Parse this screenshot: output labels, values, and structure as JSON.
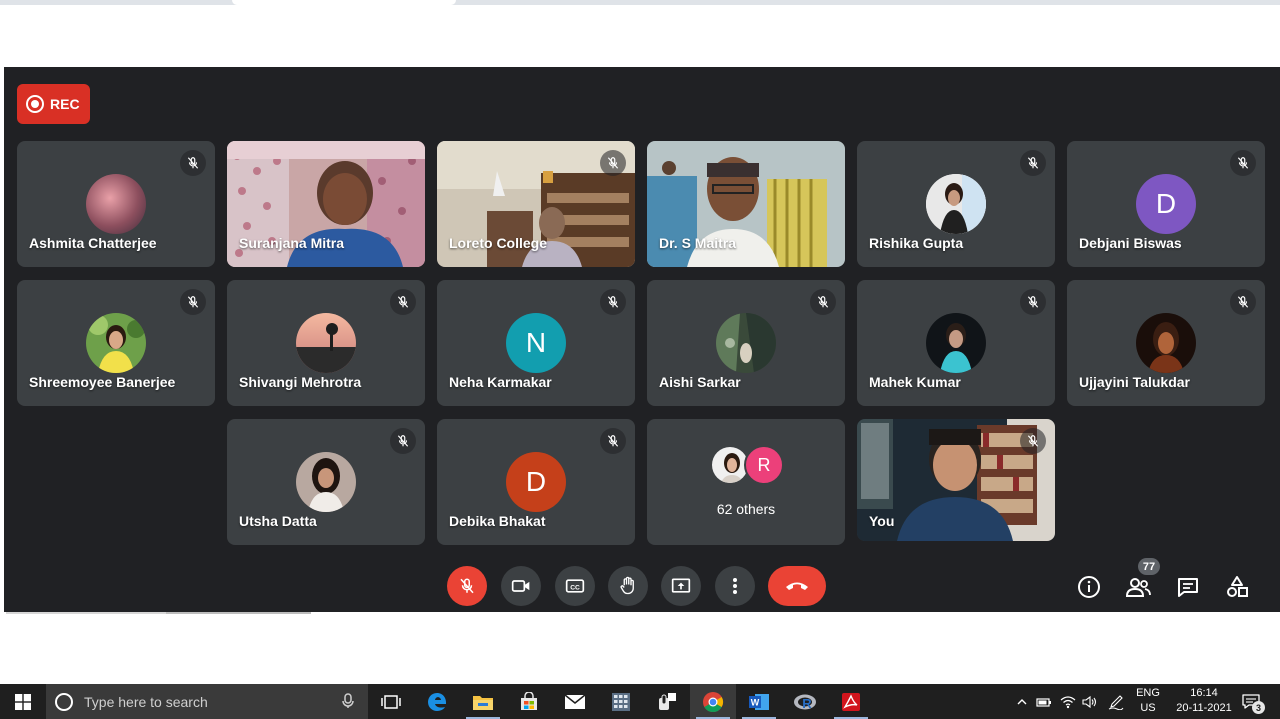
{
  "recording": {
    "label": "REC"
  },
  "participants": [
    {
      "name": "Ashmita Chatterjee"
    },
    {
      "name": "Suranjana Mitra"
    },
    {
      "name": "Loreto College"
    },
    {
      "name": "Dr. S Maitra"
    },
    {
      "name": "Rishika Gupta"
    },
    {
      "name": "Debjani Biswas",
      "initial": "D",
      "color": "#7e57c2"
    },
    {
      "name": "Shreemoyee Banerjee"
    },
    {
      "name": "Shivangi Mehrotra"
    },
    {
      "name": "Neha Karmakar",
      "initial": "N",
      "color": "#129eaf"
    },
    {
      "name": "Aishi Sarkar"
    },
    {
      "name": "Mahek Kumar"
    },
    {
      "name": "Ujjayini Talukdar"
    },
    {
      "name": "Utsha Datta"
    },
    {
      "name": "Debika Bhakat",
      "initial": "D",
      "color": "#c5401a"
    },
    {
      "name": "You"
    }
  ],
  "others": {
    "label": "62 others",
    "initial": "R",
    "color": "#ec407a"
  },
  "people_count": "77",
  "taskbar": {
    "search_placeholder": "Type here to search",
    "lang_line1": "ENG",
    "lang_line2": "US",
    "time": "16:14",
    "date": "20-11-2021",
    "notifications": "3"
  },
  "colors": {
    "meet_bg": "#202124",
    "tile_bg": "#3c4043",
    "rec_red": "#d93025",
    "end_red": "#ea4335",
    "taskbar_bg": "#1f1f1f"
  }
}
